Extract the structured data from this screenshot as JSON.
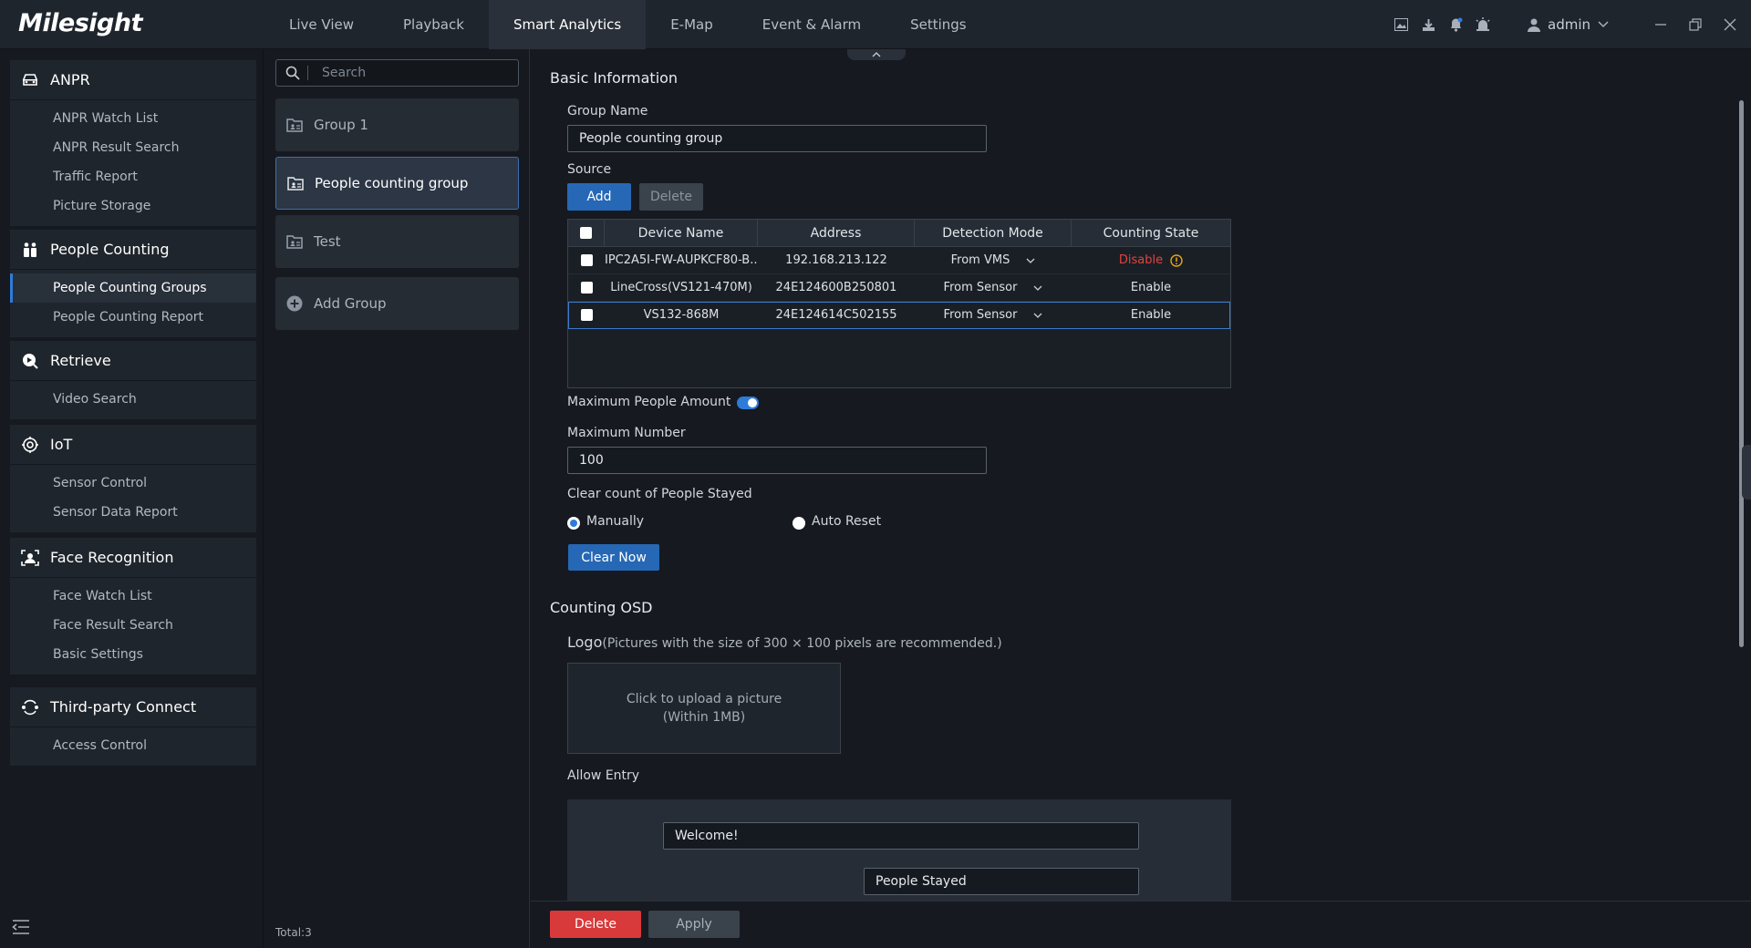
{
  "app": {
    "logo": "Milesight"
  },
  "nav": {
    "tabs": [
      "Live View",
      "Playback",
      "Smart Analytics",
      "E-Map",
      "Event & Alarm",
      "Settings"
    ],
    "active": "Smart Analytics"
  },
  "user": {
    "name": "admin"
  },
  "sidebar": {
    "sections": [
      {
        "title": "ANPR",
        "icon": "car-icon",
        "items": [
          "ANPR Watch List",
          "ANPR Result Search",
          "Traffic Report",
          "Picture Storage"
        ]
      },
      {
        "title": "People Counting",
        "icon": "people-icon",
        "items": [
          "People Counting Groups",
          "People Counting Report"
        ]
      },
      {
        "title": "Retrieve",
        "icon": "play-search-icon",
        "items": [
          "Video Search"
        ]
      },
      {
        "title": "IoT",
        "icon": "iot-icon",
        "items": [
          "Sensor Control",
          "Sensor Data Report"
        ]
      },
      {
        "title": "Face Recognition",
        "icon": "face-icon",
        "items": [
          "Face Watch List",
          "Face Result Search",
          "Basic Settings"
        ]
      },
      {
        "title": "Third-party Connect",
        "icon": "connect-icon",
        "items": [
          "Access Control"
        ]
      }
    ],
    "active_item": "People Counting Groups"
  },
  "groups": {
    "search_placeholder": "Search",
    "items": [
      "Group 1",
      "People counting group",
      "Test"
    ],
    "active": "People counting group",
    "add_label": "Add Group",
    "total": "Total:3"
  },
  "basic": {
    "title": "Basic Information",
    "group_name_label": "Group Name",
    "group_name_value": "People counting group",
    "source_label": "Source",
    "add_btn": "Add",
    "delete_btn": "Delete",
    "table": {
      "headers": [
        "Device Name",
        "Address",
        "Detection Mode",
        "Counting State"
      ],
      "rows": [
        {
          "name": "IPC2A5I-FW-AUPKCF80-B...",
          "address": "192.168.213.122",
          "mode": "From VMS",
          "state": "Disable"
        },
        {
          "name": "LineCross(VS121-470M)",
          "address": "24E124600B250801",
          "mode": "From Sensor",
          "state": "Enable"
        },
        {
          "name": "VS132-868M",
          "address": "24E124614C502155",
          "mode": "From Sensor",
          "state": "Enable"
        }
      ]
    },
    "max_people_label": "Maximum People Amount",
    "max_people_enabled": true,
    "max_number_label": "Maximum Number",
    "max_number_value": "100",
    "clear_label": "Clear count of People Stayed",
    "radio_manual": "Manually",
    "radio_auto": "Auto Reset",
    "radio_selected": "Manually",
    "clear_now_btn": "Clear Now"
  },
  "osd": {
    "title": "Counting OSD",
    "logo_label": "Logo",
    "logo_hint": "(Pictures with the size of 300 × 100 pixels are recommended.)",
    "upload_line1": "Click to upload a picture",
    "upload_line2": "(Within 1MB)",
    "allow_entry_label": "Allow Entry",
    "welcome_value": "Welcome!",
    "stayed_value": "People Stayed"
  },
  "footer": {
    "delete_btn": "Delete",
    "apply_btn": "Apply"
  },
  "colors": {
    "accent": "#2f7bd9",
    "danger": "#d8393a",
    "warning": "#e8a317"
  }
}
